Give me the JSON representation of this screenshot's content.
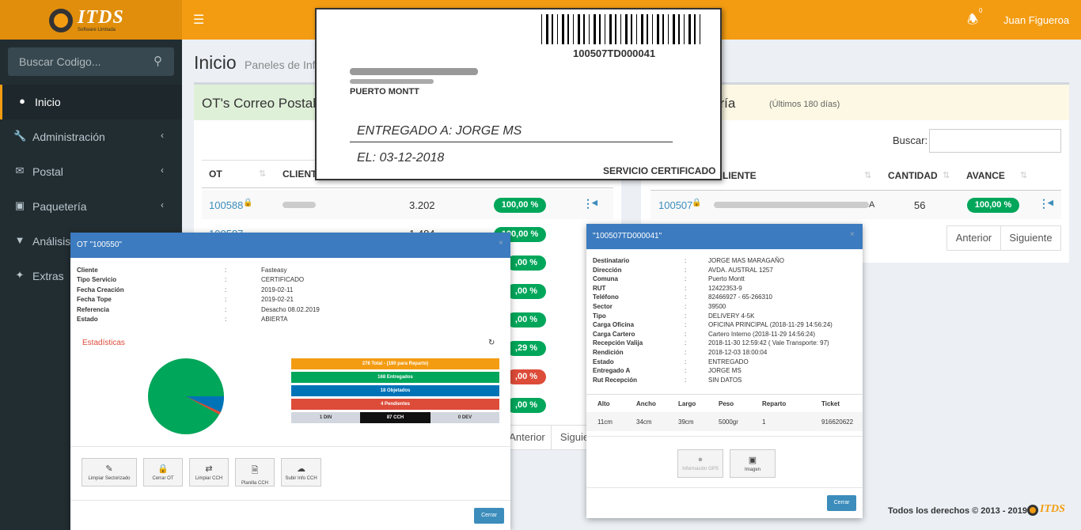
{
  "header": {
    "brand": "ITDS",
    "brand_sub": "Software Limitada",
    "notif_count": "0",
    "user": "Juan Figueroa"
  },
  "sidebar": {
    "search_placeholder": "Buscar Codigo...",
    "items": [
      {
        "label": "Inicio"
      },
      {
        "label": "Administración"
      },
      {
        "label": "Postal"
      },
      {
        "label": "Paquetería"
      },
      {
        "label": "Análisis"
      },
      {
        "label": "Extras"
      }
    ]
  },
  "page": {
    "title": "Inicio",
    "subtitle": "Paneles de Info"
  },
  "left_panel": {
    "title": "OT's Correo Postal",
    "col_ot": "OT",
    "col_cliente": "CLIENT",
    "rows": [
      {
        "ot": "100588",
        "cantidad": "3.202",
        "avance": "100,00 %"
      },
      {
        "ot": "100587",
        "cantidad": "1.484",
        "avance": "100,00 %"
      }
    ],
    "more_avance": [
      "100,00 %",
      ",00 %",
      ",00 %",
      ",00 %",
      ",29 %",
      ",00 %"
    ],
    "pager_prev": "Anterior",
    "pager_next": "Siguie"
  },
  "right_panel": {
    "title": "ería",
    "title_sub": "(Últimos 180 días)",
    "search_label": "Buscar:",
    "col_cliente": "LIENTE",
    "col_cantidad": "CANTIDAD",
    "col_avance": "AVANCE",
    "row": {
      "ot": "100507",
      "tail": "A",
      "cantidad": "56",
      "avance": "100,00 %"
    },
    "pager_prev": "Anterior",
    "pager_next": "Siguiente"
  },
  "label_card": {
    "barcode": "100507TD000041",
    "city": "PUERTO MONTT",
    "entregado": "ENTREGADO A:  JORGE MS",
    "fecha": "EL:  03-12-2018",
    "servicio": "SERVICIO CERTIFICADO"
  },
  "modal_ot": {
    "title": "OT \"100550\"",
    "close": "×",
    "fields": [
      {
        "k": "Cliente",
        "v": "Fasteasy"
      },
      {
        "k": "Tipo Servicio",
        "v": "CERTIFICADO"
      },
      {
        "k": "Fecha Creación",
        "v": "2019-02-11"
      },
      {
        "k": "Fecha Tope",
        "v": "2019-02-21"
      },
      {
        "k": "Referencia",
        "v": "Desacho 08.02.2019"
      },
      {
        "k": "Estado",
        "v": "ABIERTA"
      }
    ],
    "stats_title": "Estadísticas",
    "bars": {
      "total": "278 Total - (190 para Reparto)",
      "entregados": "168 Entregados",
      "objetados": "18 Objetados",
      "pendientes": "4 Pendientes",
      "din": "1 DIN",
      "cch": "87 CCH",
      "dev": "0 DEV"
    },
    "buttons": [
      "Limpiar Sectorizado",
      "Cerrar OT",
      "Limpiar CCH",
      "Planilla CCH",
      "Subir Info CCH"
    ],
    "cerrar": "Cerrar",
    "colors": {
      "green": "#00a65a",
      "blue": "#0073b7",
      "red": "#dd4b39",
      "orange": "#f39c12"
    }
  },
  "modal_pkg": {
    "title": "\"100507TD000041\"",
    "close": "×",
    "fields": [
      {
        "k": "Destinatario",
        "v": "JORGE MAS MARAGAÑO"
      },
      {
        "k": "Dirección",
        "v": "AVDA. AUSTRAL 1257"
      },
      {
        "k": "Comuna",
        "v": "Puerto Montt"
      },
      {
        "k": "RUT",
        "v": "12422353-9"
      },
      {
        "k": "Teléfono",
        "v": "82466927 - 65-266310"
      },
      {
        "k": "Sector",
        "v": "39500"
      },
      {
        "k": "Tipo",
        "v": "DELIVERY 4-5K"
      },
      {
        "k": "Carga Oficina",
        "v": "OFICINA PRINCIPAL (2018-11-29 14:56:24)"
      },
      {
        "k": "Carga Cartero",
        "v": "Cartero Interno (2018-11-29 14:56:24)"
      },
      {
        "k": "Recepción Valija",
        "v": "2018-11-30 12:59:42 ( Vale Transporte: 97)"
      },
      {
        "k": "Rendición",
        "v": "2018-12-03 18:00:04"
      },
      {
        "k": "Estado",
        "v": "ENTREGADO"
      },
      {
        "k": "Entregado A",
        "v": "JORGE MS"
      },
      {
        "k": "Rut Recepción",
        "v": "SIN DATOS"
      }
    ],
    "table_headers": [
      "Alto",
      "Ancho",
      "Largo",
      "Peso",
      "Reparto",
      "Ticket"
    ],
    "table_row": [
      "11cm",
      "34cm",
      "39cm",
      "5000gr",
      "1",
      "916620622"
    ],
    "btn_gps": "Información GPS",
    "btn_img": "Imagen",
    "cerrar": "Cerrar"
  },
  "footer": {
    "text": "Todos los derechos © 2013 - 2019",
    "brand": "ITDS"
  }
}
